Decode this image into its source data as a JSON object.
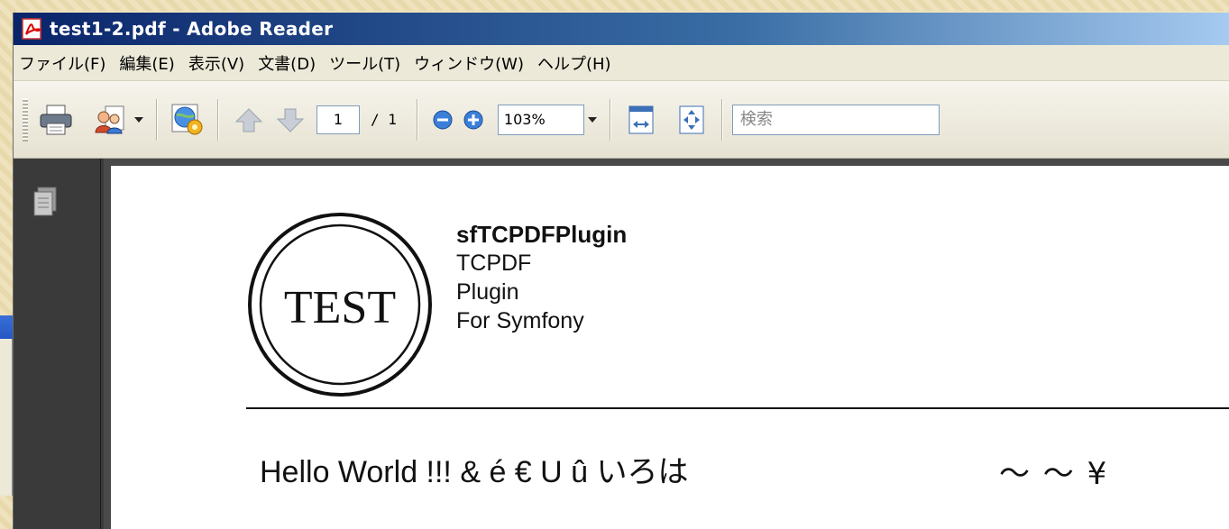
{
  "window": {
    "title": "test1-2.pdf - Adobe Reader"
  },
  "menu": [
    "ファイル(F)",
    "編集(E)",
    "表示(V)",
    "文書(D)",
    "ツール(T)",
    "ウィンドウ(W)",
    "ヘルプ(H)"
  ],
  "toolbar": {
    "page_current": "1",
    "page_total": "/ 1",
    "zoom": "103%",
    "search_placeholder": "検索"
  },
  "document": {
    "logo_text": "TEST",
    "title": "sfTCPDFPlugin",
    "lines": [
      "TCPDF",
      "Plugin",
      "For Symfony"
    ],
    "body_text": "Hello World !!! & é € U û いろは",
    "symbols_text": "～ ～ ¥"
  },
  "icons": {
    "app": "pdf-icon",
    "print": "printer-icon",
    "collaborate": "people-icon",
    "secure": "gear-globe-icon",
    "prev": "arrow-up-icon",
    "next": "arrow-down-icon",
    "zoom_out": "minus-circle-icon",
    "zoom_in": "plus-circle-icon",
    "fit_width": "fit-width-icon",
    "fit_page": "fit-page-icon",
    "pages_panel": "pages-icon"
  },
  "colors": {
    "titlebar_start": "#0a246a",
    "titlebar_end": "#a6caf0",
    "desktop": "#efe3bd"
  }
}
